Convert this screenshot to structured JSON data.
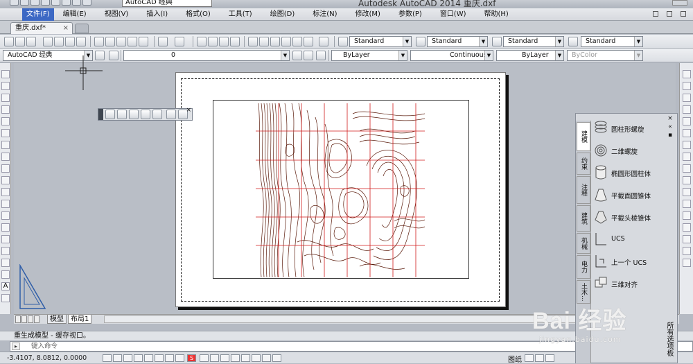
{
  "titlebar": {
    "title": "Autodesk AutoCAD 2014    重庆.dxf",
    "workspace": "AutoCAD 经典"
  },
  "menubar": {
    "items": [
      "文件(F)",
      "编辑(E)",
      "视图(V)",
      "插入(I)",
      "格式(O)",
      "工具(T)",
      "绘图(D)",
      "标注(N)",
      "修改(M)",
      "参数(P)",
      "窗口(W)",
      "帮助(H)"
    ]
  },
  "document": {
    "tab_label": "重庆.dxf*"
  },
  "toolbar": {
    "text_style": "Standard",
    "dim_style": "Standard",
    "table_style": "Standard",
    "mleader_style": "Standard",
    "workspace": "AutoCAD 经典",
    "layer": "0",
    "color": "ByLayer",
    "linetype": "Continuous",
    "lineweight": "ByLayer",
    "plotstyle": "ByColor"
  },
  "layout_tabs": {
    "model": "模型",
    "layout1": "布局1"
  },
  "command": {
    "history": "重生成模型 - 缓存视口。",
    "prompt": "键入命令"
  },
  "statusbar": {
    "coords": "-3.4107, 8.0812, 0.0000",
    "paper_label": "图纸"
  },
  "tool_palette": {
    "title": "所有选项板",
    "tabs": [
      "建模",
      "约束",
      "注释",
      "建筑",
      "机械",
      "电力",
      "土木..."
    ],
    "items": [
      "圆柱形螺旋",
      "二维螺旋",
      "椭圆形圆柱体",
      "平截面圆锥体",
      "平截头棱锥体",
      "UCS",
      "上一个 UCS",
      "三维对齐"
    ]
  },
  "watermark": {
    "main": "Bai 经验",
    "sub": "jingyan.baidu.com"
  },
  "colors": {
    "accent": "#3c68c4",
    "contour": "#5a1a0a",
    "grid": "#d11a1a"
  }
}
